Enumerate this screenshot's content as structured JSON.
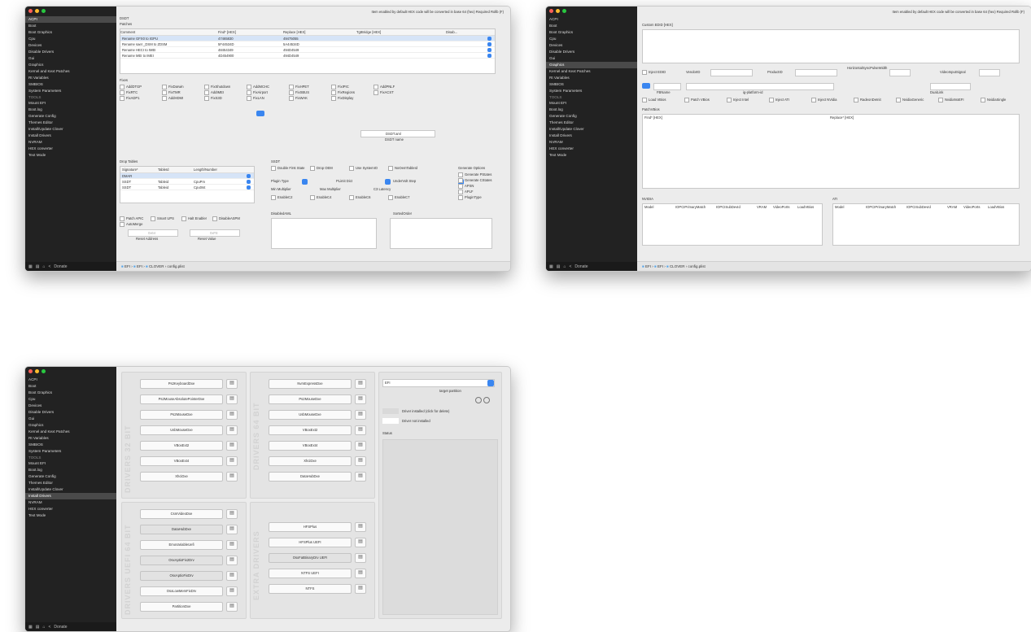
{
  "overlay_text": "Cl",
  "colors": {
    "sidebar": "#222222",
    "accent": "#3a86f0",
    "close": "#ff5f57",
    "minimize": "#febc2e",
    "zoom": "#28c840"
  },
  "sidebar": {
    "header": "",
    "items": [
      "ACPI",
      "Boot",
      "Boot Graphics",
      "Cpu",
      "Devices",
      "Disable Drivers",
      "Gui",
      "Graphics",
      "Kernel and Kext Patches",
      "Rt Variables",
      "SMBIOS",
      "System Parameters"
    ],
    "tools_header": "TOOLS",
    "tools": [
      "Mount EFI",
      "Boot.log",
      "Generate Config",
      "Themes Editor",
      "Install/Update Clover",
      "Install Drivers",
      "NVRAM",
      "HEX converter",
      "Text Mode"
    ],
    "bottom": {
      "donate": "Donate"
    }
  },
  "win1": {
    "top_notice": "Item enabled by default    HEX code will be converted in base 64 (hex)    Required Rollb (F)",
    "dsdt_label": "DSDT",
    "patches_label": "Patches",
    "patch_columns": [
      "Comment",
      "Find* [HEX]",
      "Replace [HEX]",
      "TgtBridge [HEX]",
      "Disab..."
    ],
    "patch_rows": [
      [
        "Rename GFX0 to IGPU",
        "47465830",
        "49475055"
      ],
      [
        "Rename saet _DSM to ZDSM",
        "5F44534D",
        "5A44534D"
      ],
      [
        "Rename HECI to IMEI",
        "48454349",
        "494D4549"
      ],
      [
        "Rename MEI to IMEI",
        "4D454900",
        "494D4549"
      ]
    ],
    "fixes_label": "Fixes",
    "fixes": [
      "AddDTGP",
      "FixDarwin",
      "FixShutdown",
      "AddMCHC",
      "FixHPET",
      "FixIPIC",
      "AddPNLF",
      "FixRTC",
      "FixTMR",
      "AddIMEI",
      "FixAirport",
      "FixSBUS",
      "FixRegions",
      "FixACST",
      "FixADP1",
      "AddHDMI",
      "FixS3D",
      "FixLAN",
      "FixWAK",
      "FixDisplay"
    ],
    "drop_tables_label": "Drop Tables",
    "drop_columns": [
      "Signature*",
      "TableId",
      "Length/Number"
    ],
    "drop_rows": [
      [
        "DMAR",
        "",
        ""
      ],
      [
        "SSDT",
        "Tableid",
        "CpuPm"
      ],
      [
        "SSDT",
        "Tableid",
        "Cpu0Ist"
      ]
    ],
    "ssdt_label": "SSDT",
    "ssdt_opts": [
      "Double First State",
      "Drop OEM",
      "Use SystemIO",
      "NoOemTableId"
    ],
    "generate_label": "Generate Options",
    "generate_opts": [
      "Generate PStates",
      "Generate CStates",
      "APSN",
      "APLF",
      "PluginType"
    ],
    "min_multiplier": "Min Multiplier",
    "max_multiplier": "Max Multiplier",
    "plugin_type": "Plugin Type",
    "pstate_limit": "PLimit Dict",
    "underVolt": "UnderVolt Step",
    "c_latency": "C3 Latency",
    "enable_c": [
      "EnableC2",
      "EnableC4",
      "EnableC6",
      "EnableC7"
    ],
    "disabled_aml": "DisabledAML",
    "sorted_order": "SortedOrder",
    "reset_address": "Reset Address",
    "reset_value": "Reset Value",
    "reset_address_val": "0x64",
    "reset_value_val": "0xFE",
    "dsdt_name": "DSDT.aml",
    "dsdt_name_label": "DSDT name",
    "misc_opts": [
      "Patch APIC",
      "Smart UPS",
      "Halt Enabler",
      "DisableASPM",
      "AutoMerge"
    ],
    "breadcrumb": [
      "EFI",
      "EFI",
      "CLOVER",
      "config.plist"
    ]
  },
  "win2": {
    "top_notice": "Item enabled by default    HEX code will be converted in base 64 (hex)    Required Rollb (F)",
    "custom_edid": "Custom EDID [HEX]",
    "inject_edid": "Inject EDID",
    "vendor_id": "VendorID",
    "product_id": "ProductID",
    "horizontal_sync": "HorizontalSyncPulseWidth",
    "video_input": "VideoInputSignal",
    "framebuffer": "FBName",
    "ig_platform": "ig-platform-id",
    "display_cfg": "DualLink",
    "inject_opts": [
      "Load VBios",
      "Patch VBios",
      "Inject Intel",
      "Inject ATI",
      "Inject NVidia",
      "RadeonDeInit",
      "NvidiaGeneric",
      "NvidiaNoEFI",
      "NvidiaSingle"
    ],
    "patch_vbios_label": "PatchVBios",
    "find_col": "Find* [HEX]",
    "replace_col": "Replace* [HEX]",
    "nvidia_label": "NVIDIA",
    "ati_label": "ATI",
    "nvidia_cols": [
      "Model",
      "IOPCIPrimaryMatch",
      "IOPCISubDevId",
      "VRAM",
      "VideoPorts",
      "LoadVBios"
    ],
    "ati_cols": [
      "Model",
      "IOPCIPrimaryMatch",
      "IOPCISubDevId",
      "VRAM",
      "VideoPorts",
      "LoadVBios"
    ],
    "breadcrumb": [
      "EFI",
      "EFI",
      "CLOVER",
      "config.plist"
    ]
  },
  "win3": {
    "drivers32_label": "DRIVERS 32 BIT",
    "drivers32": [
      "Ps2KeyboardDxe",
      "Ps2MouseAbsolutePointerDxe",
      "Ps2MouseDxe",
      "UsbMouseDxe",
      "VBoxExt2",
      "VBoxExt4",
      "XhciDxe"
    ],
    "drivers64_label": "DRIVERS 64 BIT",
    "drivers64": [
      "NvmExpressDxe",
      "Ps2MouseDxe",
      "UsbMouseDxe",
      "VBoxExt2",
      "VBoxExt4",
      "XhciDxe",
      "DataHubDxe"
    ],
    "uefi64_label": "DRIVERS UEFI 64 BIT",
    "uefi64": [
      "CsmVideoDxe",
      "DataHubDxe",
      "EmuVariableUefi",
      "OsxAptioFix2Drv",
      "OsxAptioFixDrv",
      "OsxLowMemFixDrv",
      "PartitionDxe"
    ],
    "extra_label": "EXTRA DRIVERS",
    "extra": [
      "HFSPlus",
      "HFSPlus UEFI",
      "OsxFatBinaryDrv UEFI",
      "NTFS UEFI",
      "NTFS"
    ],
    "efi_select": "EFI",
    "target_partition": "target partition",
    "legend_loaded": "Driver installed (click for delete)",
    "legend_not": "Driver not installed",
    "status_label": "Status"
  }
}
